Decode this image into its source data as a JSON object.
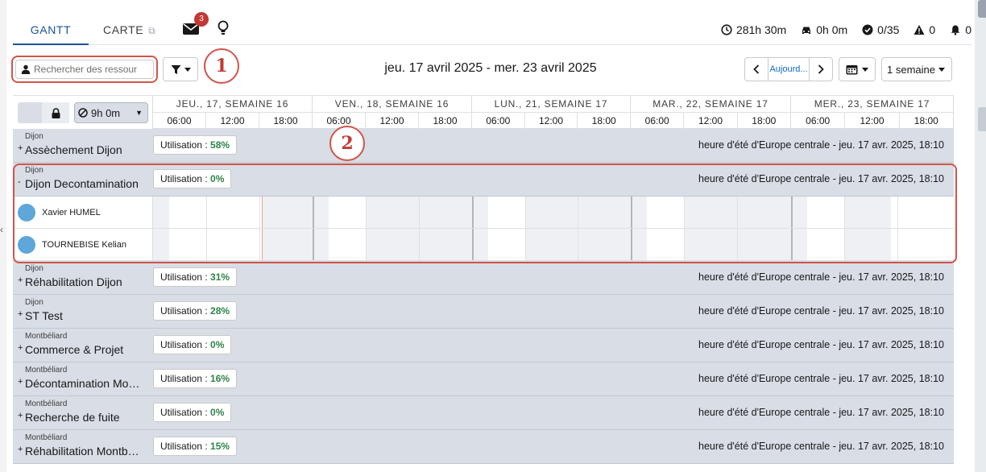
{
  "tabs": {
    "gantt": "GANTT",
    "carte": "CARTE",
    "notification_badge": "3"
  },
  "stats": {
    "hours": "281h 30m",
    "travel": "0h 0m",
    "completed": "0/35",
    "warnings": "0",
    "alerts": "0"
  },
  "toolbar": {
    "search_placeholder": "Rechercher des ressour",
    "date_range": "jeu. 17 avril 2025 - mer. 23 avril 2025",
    "today_label": "Aujourd...",
    "period_select": "1 semaine"
  },
  "callouts": {
    "one": "1",
    "two": "2"
  },
  "gantt_header": {
    "duration_filter": "9h 0m",
    "days": [
      {
        "label": "JEU., 17, SEMAINE 16"
      },
      {
        "label": "VEN., 18, SEMAINE 16"
      },
      {
        "label": "LUN., 21, SEMAINE 17"
      },
      {
        "label": "MAR., 22, SEMAINE 17"
      },
      {
        "label": "MER., 23, SEMAINE 17"
      }
    ],
    "hours": [
      "06:00",
      "12:00",
      "18:00"
    ]
  },
  "timezone_text": "heure d'été d'Europe centrale - jeu. 17 avr. 2025, 18:10",
  "groups": [
    {
      "city": "Dijon",
      "name": "Assèchement Dijon",
      "expander": "+",
      "util_label": "Utilisation : ",
      "util_value": "58%"
    },
    {
      "city": "Dijon",
      "name": "Dijon Decontamination",
      "expander": "-",
      "util_label": "Utilisation : ",
      "util_value": "0%"
    },
    {
      "city": "Dijon",
      "name": "Réhabilitation Dijon",
      "expander": "+",
      "util_label": "Utilisation : ",
      "util_value": "31%"
    },
    {
      "city": "Dijon",
      "name": "ST Test",
      "expander": "+",
      "util_label": "Utilisation : ",
      "util_value": "28%"
    },
    {
      "city": "Montbéliard",
      "name": "Commerce & Projet",
      "expander": "+",
      "util_label": "Utilisation : ",
      "util_value": "0%"
    },
    {
      "city": "Montbéliard",
      "name": "Décontamination Mo…",
      "expander": "+",
      "util_label": "Utilisation : ",
      "util_value": "16%"
    },
    {
      "city": "Montbéliard",
      "name": "Recherche de fuite",
      "expander": "+",
      "util_label": "Utilisation : ",
      "util_value": "0%"
    },
    {
      "city": "Montbéliard",
      "name": "Réhabilitation Montb…",
      "expander": "+",
      "util_label": "Utilisation : ",
      "util_value": "15%"
    }
  ],
  "resources": [
    {
      "name": "Xavier HUMEL"
    },
    {
      "name": "TOURNEBISE Kelian"
    }
  ]
}
